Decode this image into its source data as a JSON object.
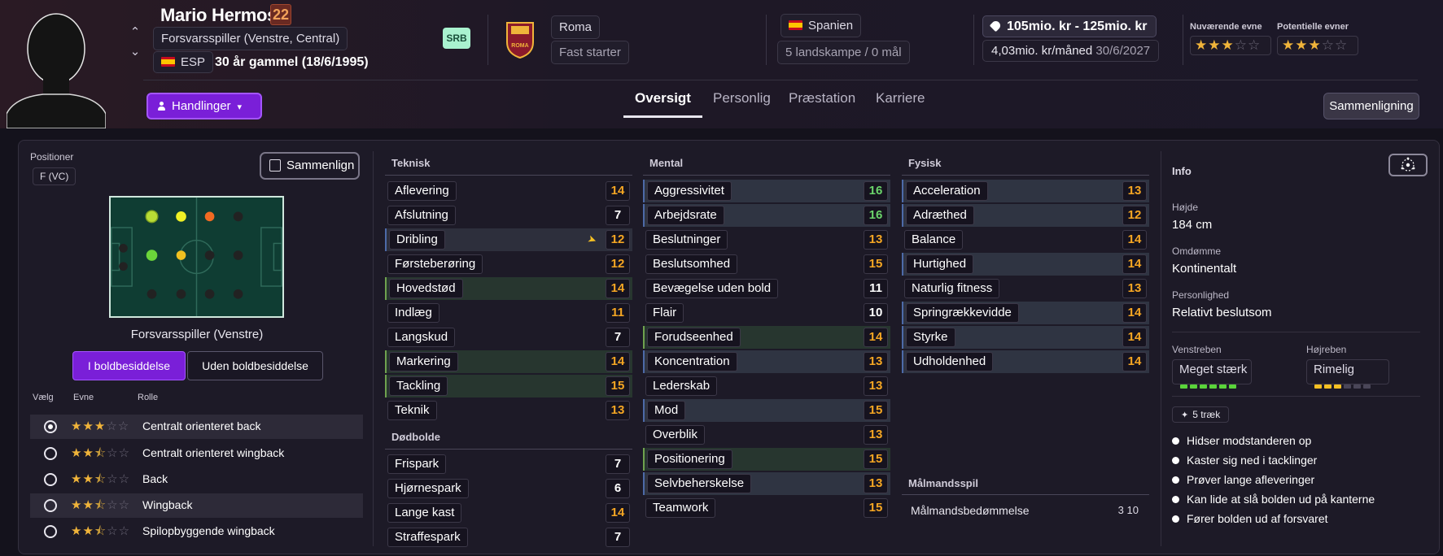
{
  "player": {
    "name": "Mario Hermoso",
    "number": "22",
    "position": "Forsvarsspiller (Venstre, Central)",
    "nationality_code": "ESP",
    "age": "30 år gammel (18/6/1995)",
    "league_badge": "SRB"
  },
  "club": {
    "name": "Roma",
    "status": "Fast starter",
    "logo_text": "ROMA"
  },
  "country": {
    "name": "Spanien",
    "caps": "5 landskampe / 0 mål"
  },
  "contract": {
    "value": "105mio. kr - 125mio. kr",
    "wage": "4,03mio. kr/måned",
    "expires": "30/6/2027"
  },
  "ability": {
    "current_label": "Nuværende evne",
    "potential_label": "Potentielle evner",
    "current_stars": 3,
    "potential_stars": 3
  },
  "nav": {
    "actions": "Handlinger",
    "tabs": [
      "Oversigt",
      "Personlig",
      "Præstation",
      "Karriere"
    ],
    "active_tab": "Oversigt",
    "compare": "Sammenligning"
  },
  "positions": {
    "title": "Positioner",
    "badge": "F (VC)",
    "compare_btn": "Sammenlign",
    "pitch_label": "Forsvarsspiller (Venstre)",
    "in_possession": "I boldbesiddelse",
    "out_possession": "Uden boldbesiddelse",
    "col_select": "Vælg",
    "col_ability": "Evne",
    "col_role": "Rolle",
    "roles": [
      {
        "name": "Centralt orienteret back",
        "stars": 3,
        "selected": true
      },
      {
        "name": "Centralt orienteret wingback",
        "stars": 2.5,
        "selected": false
      },
      {
        "name": "Back",
        "stars": 2.5,
        "selected": false
      },
      {
        "name": "Wingback",
        "stars": 2.5,
        "selected": false
      },
      {
        "name": "Spilopbyggende wingback",
        "stars": 2.5,
        "selected": false
      }
    ]
  },
  "attributes": {
    "technical_title": "Teknisk",
    "technical": [
      {
        "name": "Aflevering",
        "value": "14"
      },
      {
        "name": "Afslutning",
        "value": "7"
      },
      {
        "name": "Dribling",
        "value": "12"
      },
      {
        "name": "Førsteberøring",
        "value": "12"
      },
      {
        "name": "Hovedstød",
        "value": "14"
      },
      {
        "name": "Indlæg",
        "value": "11"
      },
      {
        "name": "Langskud",
        "value": "7"
      },
      {
        "name": "Markering",
        "value": "14"
      },
      {
        "name": "Tackling",
        "value": "15"
      },
      {
        "name": "Teknik",
        "value": "13"
      }
    ],
    "setpieces_title": "Dødbolde",
    "setpieces": [
      {
        "name": "Frispark",
        "value": "7"
      },
      {
        "name": "Hjørnespark",
        "value": "6"
      },
      {
        "name": "Lange kast",
        "value": "14"
      },
      {
        "name": "Straffespark",
        "value": "7"
      }
    ],
    "mental_title": "Mental",
    "mental": [
      {
        "name": "Aggressivitet",
        "value": "16"
      },
      {
        "name": "Arbejdsrate",
        "value": "16"
      },
      {
        "name": "Beslutninger",
        "value": "13"
      },
      {
        "name": "Beslutsomhed",
        "value": "15"
      },
      {
        "name": "Bevægelse uden bold",
        "value": "11"
      },
      {
        "name": "Flair",
        "value": "10"
      },
      {
        "name": "Forudseenhed",
        "value": "14"
      },
      {
        "name": "Koncentration",
        "value": "13"
      },
      {
        "name": "Lederskab",
        "value": "13"
      },
      {
        "name": "Mod",
        "value": "15"
      },
      {
        "name": "Overblik",
        "value": "13"
      },
      {
        "name": "Positionering",
        "value": "15"
      },
      {
        "name": "Selvbeherskelse",
        "value": "13"
      },
      {
        "name": "Teamwork",
        "value": "15"
      }
    ],
    "physical_title": "Fysisk",
    "physical": [
      {
        "name": "Acceleration",
        "value": "13"
      },
      {
        "name": "Adræthed",
        "value": "12"
      },
      {
        "name": "Balance",
        "value": "14"
      },
      {
        "name": "Hurtighed",
        "value": "14"
      },
      {
        "name": "Naturlig fitness",
        "value": "13"
      },
      {
        "name": "Springrækkevidde",
        "value": "14"
      },
      {
        "name": "Styrke",
        "value": "14"
      },
      {
        "name": "Udholdenhed",
        "value": "14"
      }
    ],
    "gk_title": "Målmandsspil",
    "gk_name": "Målmandsbedømmelse",
    "gk_value": "3",
    "gk_max": "10"
  },
  "info": {
    "title": "Info",
    "height_label": "Højde",
    "height": "184 cm",
    "reputation_label": "Omdømme",
    "reputation": "Kontinentalt",
    "personality_label": "Personlighed",
    "personality": "Relativt beslutsom",
    "left_foot_label": "Venstreben",
    "left_foot": "Meget stærk",
    "left_foot_level": 6,
    "right_foot_label": "Højreben",
    "right_foot": "Rimelig",
    "right_foot_level": 3,
    "traits_chip": "5 træk",
    "traits": [
      "Hidser modstanderen op",
      "Kaster sig ned i tacklinger",
      "Prøver lange afleveringer",
      "Kan lide at slå bolden ud på kanterne",
      "Fører bolden ud af forsvaret"
    ]
  },
  "colors": {
    "accent": "#7a1fd8",
    "value_orange": "#f5a623",
    "value_green": "#6bd46b",
    "star": "#f0b43a"
  }
}
